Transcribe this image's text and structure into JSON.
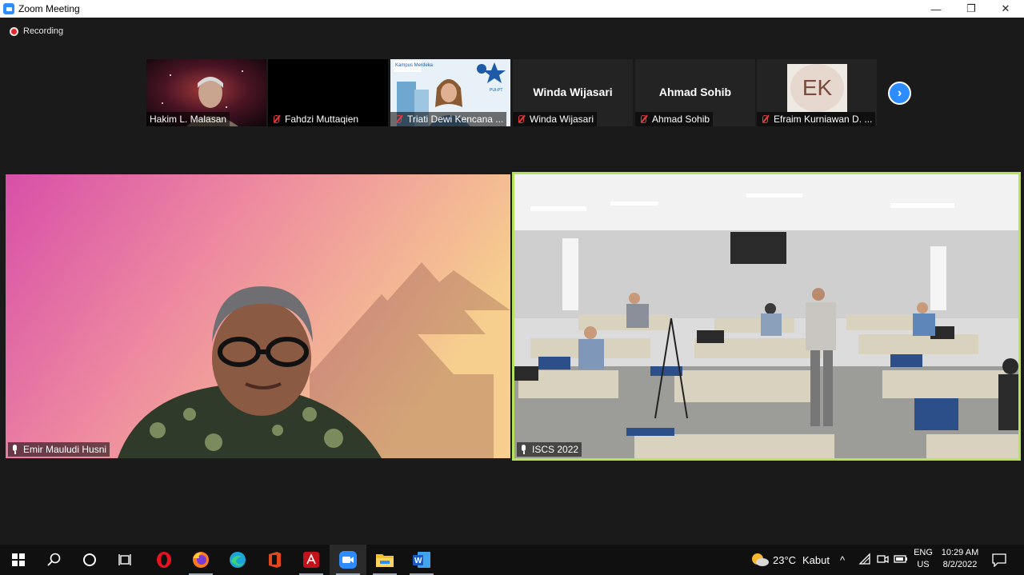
{
  "window": {
    "title": "Zoom Meeting",
    "minimize": "—",
    "restore": "❐",
    "close": "✕"
  },
  "recording": {
    "label": "Recording",
    "color": "#e02828"
  },
  "participants_strip": [
    {
      "name": "Hakim L. Malasan",
      "muted": false
    },
    {
      "name": "Fahdzi Muttaqien",
      "muted": true
    },
    {
      "name": "Triati Dewi Kencana ...",
      "muted": true
    },
    {
      "name": "Winda Wijasari",
      "display": "Winda Wijasari",
      "muted": true
    },
    {
      "name": "Ahmad Sohib",
      "display": "Ahmad Sohib",
      "muted": true
    },
    {
      "name": "Efraim Kurniawan D. ...",
      "initials": "EK",
      "muted": true
    }
  ],
  "thumb_texts": {
    "kampus": "Kampus Merdeka",
    "pui": "PUI-PT"
  },
  "next_page": {
    "icon": "chevron-right-icon",
    "glyph": "›"
  },
  "main_tiles": [
    {
      "name": "Emir Mauludi Husni"
    },
    {
      "name": "ISCS 2022",
      "active_speaker": true,
      "highlight_color": "#b7e35a"
    }
  ],
  "taskbar": {
    "apps": [
      "windows-start-icon",
      "search-icon",
      "cortana-icon",
      "task-view-icon",
      "opera-icon",
      "firefox-icon",
      "edge-icon",
      "office-icon",
      "acrobat-icon",
      "zoom-icon",
      "file-explorer-icon",
      "word-icon"
    ],
    "weather": {
      "temp": "23°C",
      "condition": "Kabut"
    },
    "language": {
      "line1": "ENG",
      "line2": "US"
    },
    "clock": {
      "time": "10:29 AM",
      "date": "8/2/2022"
    }
  },
  "colors": {
    "zoom_blue": "#2d8cff",
    "mute_red": "#e83a3a",
    "background": "#1a1a1a"
  }
}
